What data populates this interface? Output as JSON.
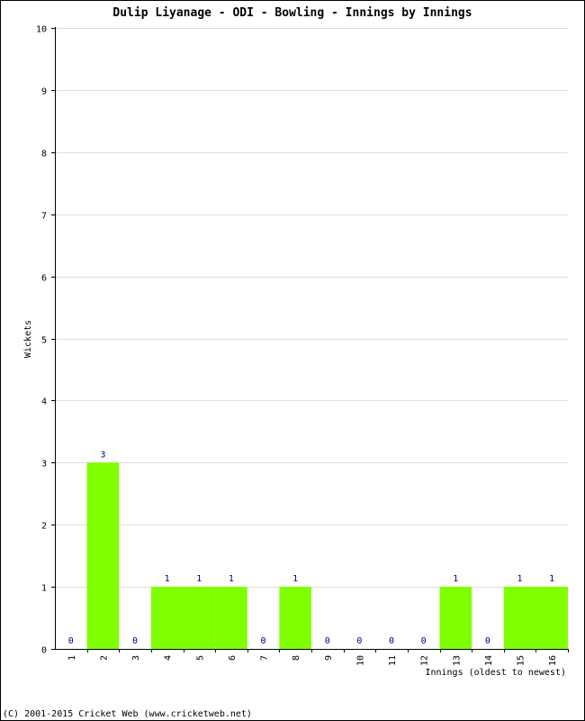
{
  "chart_data": {
    "type": "bar",
    "title": "Dulip Liyanage - ODI - Bowling - Innings by Innings",
    "xlabel": "Innings (oldest to newest)",
    "ylabel": "Wickets",
    "categories": [
      "1",
      "2",
      "3",
      "4",
      "5",
      "6",
      "7",
      "8",
      "9",
      "10",
      "11",
      "12",
      "13",
      "14",
      "15",
      "16"
    ],
    "values": [
      0,
      3,
      0,
      1,
      1,
      1,
      0,
      1,
      0,
      0,
      0,
      0,
      1,
      0,
      1,
      1
    ],
    "ylim": [
      0,
      10
    ],
    "yticks": [
      0,
      1,
      2,
      3,
      4,
      5,
      6,
      7,
      8,
      9,
      10
    ],
    "grid": true,
    "bar_color": "#80ff00",
    "label_color": "#000080",
    "grid_color": "#dddddd"
  },
  "footer": "(C) 2001-2015 Cricket Web (www.cricketweb.net)"
}
